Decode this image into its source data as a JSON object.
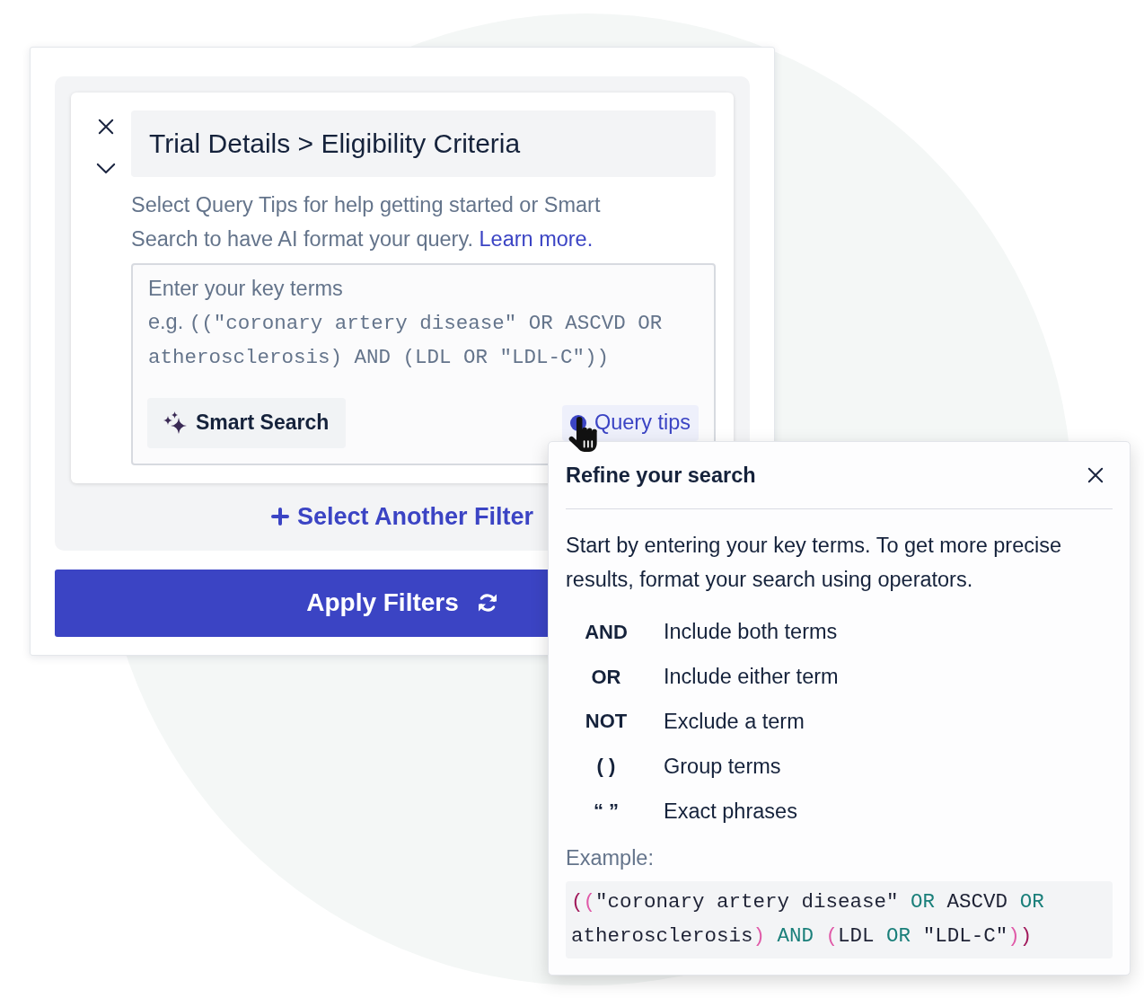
{
  "filter_panel": {
    "filter": {
      "breadcrumb": "Trial Details > Eligibility Criteria",
      "help_text": "Select Query Tips for help getting started or Smart Search to have AI format your query.",
      "help_link": "Learn more.",
      "query_field": {
        "placeholder": "Enter your key terms",
        "example_label": "e.g.",
        "example": "((\"coronary artery disease\" OR ASCVD OR atherosclerosis) AND (LDL OR \"LDL-C\"))"
      },
      "smart_search_button": "Smart Search",
      "query_tips_button": "Query tips"
    },
    "add_filter_button": "Select Another Filter",
    "apply_button": "Apply Filters"
  },
  "query_tips_popover": {
    "title": "Refine your search",
    "intro": "Start by entering your key terms. To get more precise results, format your search using operators.",
    "operators": [
      {
        "operator": "AND",
        "description": "Include both terms"
      },
      {
        "operator": "OR",
        "description": "Include either term"
      },
      {
        "operator": "NOT",
        "description": "Exclude a term"
      },
      {
        "operator": "( )",
        "description": "Group terms"
      },
      {
        "operator": "“ ”",
        "description": "Exact phrases"
      }
    ],
    "example_label": "Example:",
    "example_code": [
      {
        "kind": "outer-bracket",
        "text": "("
      },
      {
        "kind": "bracket",
        "text": "("
      },
      {
        "kind": "term",
        "text": "\"coronary artery disease\" "
      },
      {
        "kind": "operator",
        "text": "OR"
      },
      {
        "kind": "term",
        "text": " ASCVD "
      },
      {
        "kind": "operator",
        "text": "OR"
      },
      {
        "kind": "term",
        "text": " atherosclerosis"
      },
      {
        "kind": "bracket",
        "text": ")"
      },
      {
        "kind": "operator",
        "text": " AND"
      },
      {
        "kind": "bracket",
        "text": " ("
      },
      {
        "kind": "term",
        "text": "LDL "
      },
      {
        "kind": "operator",
        "text": "OR"
      },
      {
        "kind": "term",
        "text": " \"LDL-C\""
      },
      {
        "kind": "bracket",
        "text": ")"
      },
      {
        "kind": "outer-bracket",
        "text": ")"
      }
    ]
  }
}
